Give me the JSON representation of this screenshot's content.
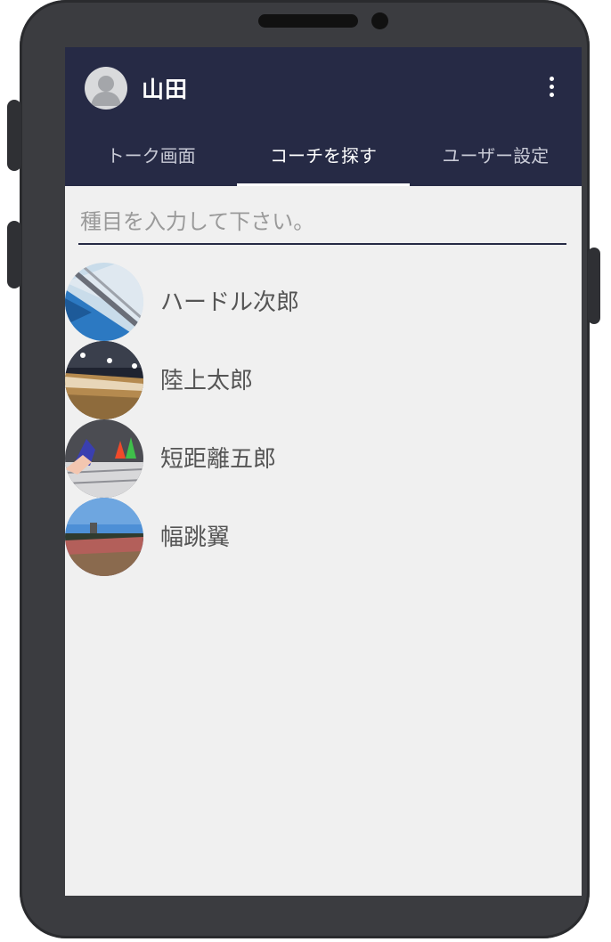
{
  "header": {
    "user_name": "山田",
    "menu_icon": "more-vert-icon"
  },
  "tabs": [
    {
      "label": "トーク画面",
      "active": false
    },
    {
      "label": "コーチを探す",
      "active": true
    },
    {
      "label": "ユーザー設定",
      "active": false
    }
  ],
  "search": {
    "placeholder": "種目を入力して下さい。",
    "value": ""
  },
  "coaches": [
    {
      "name": "ハードル次郎"
    },
    {
      "name": "陸上太郎"
    },
    {
      "name": "短距離五郎"
    },
    {
      "name": "幅跳翼"
    }
  ],
  "colors": {
    "appbar": "#262a45",
    "screen_bg": "#f0f0f0",
    "phone_frame": "#3b3c40"
  }
}
